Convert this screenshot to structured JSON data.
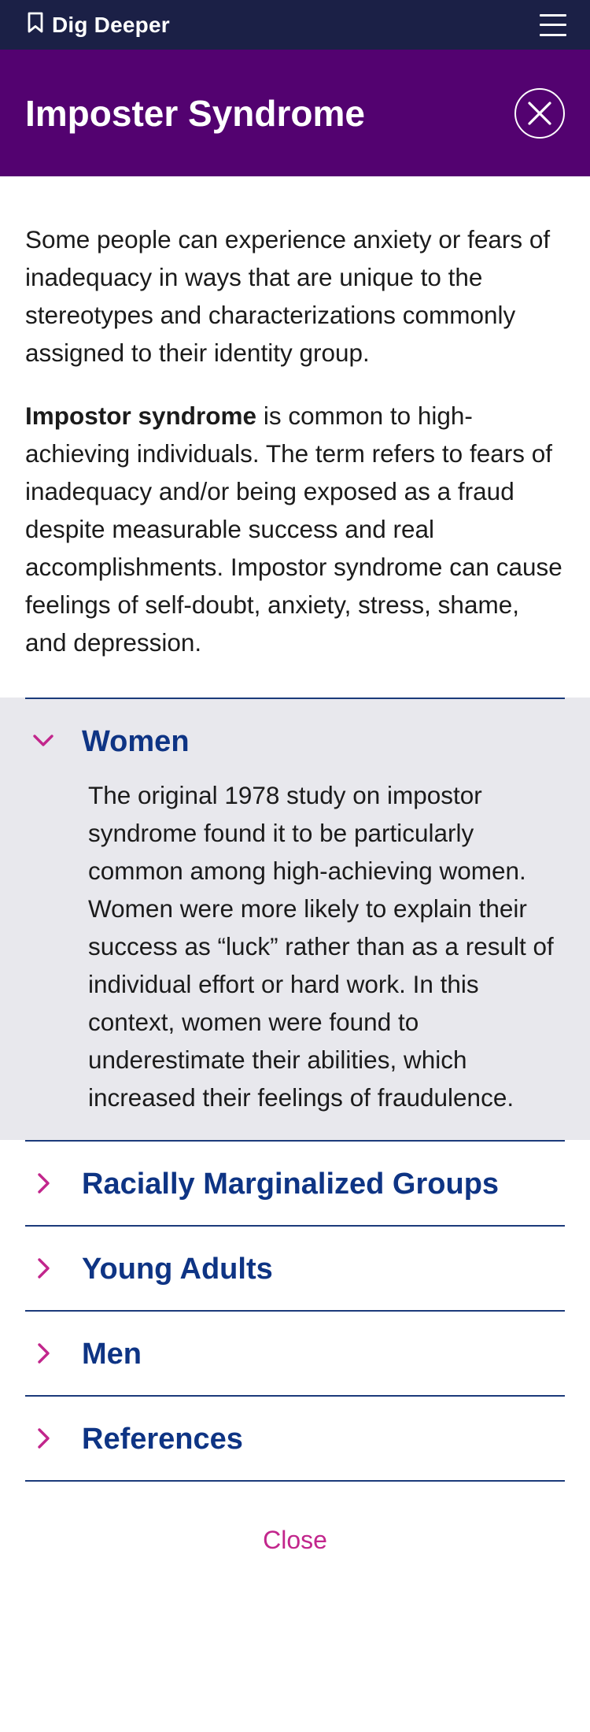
{
  "topbar": {
    "brand_label": "Dig Deeper",
    "brand_icon": "bookmark-icon",
    "menu_icon": "hamburger-menu-icon"
  },
  "header": {
    "title": "Imposter Syndrome",
    "close_icon": "close-icon",
    "background": "#530270"
  },
  "intro": {
    "paragraph1": "Some people can experience anxiety or fears of inadequacy in ways that are unique to the stereotypes and characterizations commonly assigned to their identity group.",
    "paragraph2_bold": "Impostor syndrome",
    "paragraph2_rest": " is common to high-achieving individuals. The term refers to fears of inadequacy and/or being exposed as a fraud despite measurable success and real accomplishments. Impostor syndrome can cause feelings of self-doubt, anxiety, stress, shame, and depression."
  },
  "accordion": {
    "open_item": {
      "title": "Women",
      "body": "The original 1978 study on impostor syndrome found it to be particularly common among high-achieving women. Women were more likely to explain their success as “luck” rather than as a result of individual effort or hard work. In this context, women were found to underestimate their abilities, which increased their feelings of fraudulence."
    },
    "items": [
      {
        "title": "Racially Marginalized Groups"
      },
      {
        "title": "Young Adults"
      },
      {
        "title": "Men"
      },
      {
        "title": "References"
      }
    ]
  },
  "footer": {
    "close_label": "Close"
  },
  "colors": {
    "topbar": "#1b2046",
    "accent": "#c2268c",
    "heading": "#0e3484",
    "open_bg": "#e8e8ed"
  }
}
